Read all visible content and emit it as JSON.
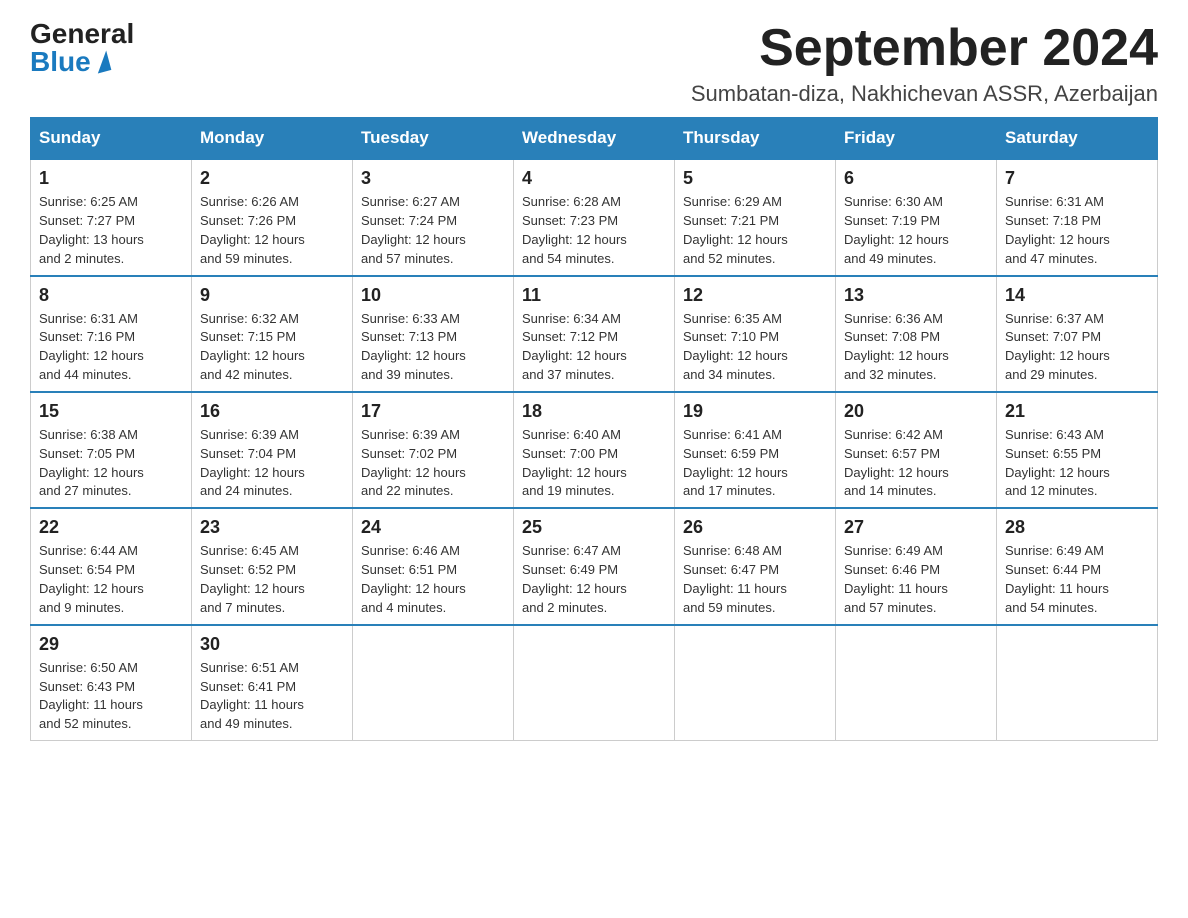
{
  "header": {
    "logo_general": "General",
    "logo_blue": "Blue",
    "month_title": "September 2024",
    "subtitle": "Sumbatan-diza, Nakhichevan ASSR, Azerbaijan"
  },
  "weekdays": [
    "Sunday",
    "Monday",
    "Tuesday",
    "Wednesday",
    "Thursday",
    "Friday",
    "Saturday"
  ],
  "weeks": [
    [
      {
        "day": "1",
        "sunrise": "6:25 AM",
        "sunset": "7:27 PM",
        "daylight": "13 hours and 2 minutes."
      },
      {
        "day": "2",
        "sunrise": "6:26 AM",
        "sunset": "7:26 PM",
        "daylight": "12 hours and 59 minutes."
      },
      {
        "day": "3",
        "sunrise": "6:27 AM",
        "sunset": "7:24 PM",
        "daylight": "12 hours and 57 minutes."
      },
      {
        "day": "4",
        "sunrise": "6:28 AM",
        "sunset": "7:23 PM",
        "daylight": "12 hours and 54 minutes."
      },
      {
        "day": "5",
        "sunrise": "6:29 AM",
        "sunset": "7:21 PM",
        "daylight": "12 hours and 52 minutes."
      },
      {
        "day": "6",
        "sunrise": "6:30 AM",
        "sunset": "7:19 PM",
        "daylight": "12 hours and 49 minutes."
      },
      {
        "day": "7",
        "sunrise": "6:31 AM",
        "sunset": "7:18 PM",
        "daylight": "12 hours and 47 minutes."
      }
    ],
    [
      {
        "day": "8",
        "sunrise": "6:31 AM",
        "sunset": "7:16 PM",
        "daylight": "12 hours and 44 minutes."
      },
      {
        "day": "9",
        "sunrise": "6:32 AM",
        "sunset": "7:15 PM",
        "daylight": "12 hours and 42 minutes."
      },
      {
        "day": "10",
        "sunrise": "6:33 AM",
        "sunset": "7:13 PM",
        "daylight": "12 hours and 39 minutes."
      },
      {
        "day": "11",
        "sunrise": "6:34 AM",
        "sunset": "7:12 PM",
        "daylight": "12 hours and 37 minutes."
      },
      {
        "day": "12",
        "sunrise": "6:35 AM",
        "sunset": "7:10 PM",
        "daylight": "12 hours and 34 minutes."
      },
      {
        "day": "13",
        "sunrise": "6:36 AM",
        "sunset": "7:08 PM",
        "daylight": "12 hours and 32 minutes."
      },
      {
        "day": "14",
        "sunrise": "6:37 AM",
        "sunset": "7:07 PM",
        "daylight": "12 hours and 29 minutes."
      }
    ],
    [
      {
        "day": "15",
        "sunrise": "6:38 AM",
        "sunset": "7:05 PM",
        "daylight": "12 hours and 27 minutes."
      },
      {
        "day": "16",
        "sunrise": "6:39 AM",
        "sunset": "7:04 PM",
        "daylight": "12 hours and 24 minutes."
      },
      {
        "day": "17",
        "sunrise": "6:39 AM",
        "sunset": "7:02 PM",
        "daylight": "12 hours and 22 minutes."
      },
      {
        "day": "18",
        "sunrise": "6:40 AM",
        "sunset": "7:00 PM",
        "daylight": "12 hours and 19 minutes."
      },
      {
        "day": "19",
        "sunrise": "6:41 AM",
        "sunset": "6:59 PM",
        "daylight": "12 hours and 17 minutes."
      },
      {
        "day": "20",
        "sunrise": "6:42 AM",
        "sunset": "6:57 PM",
        "daylight": "12 hours and 14 minutes."
      },
      {
        "day": "21",
        "sunrise": "6:43 AM",
        "sunset": "6:55 PM",
        "daylight": "12 hours and 12 minutes."
      }
    ],
    [
      {
        "day": "22",
        "sunrise": "6:44 AM",
        "sunset": "6:54 PM",
        "daylight": "12 hours and 9 minutes."
      },
      {
        "day": "23",
        "sunrise": "6:45 AM",
        "sunset": "6:52 PM",
        "daylight": "12 hours and 7 minutes."
      },
      {
        "day": "24",
        "sunrise": "6:46 AM",
        "sunset": "6:51 PM",
        "daylight": "12 hours and 4 minutes."
      },
      {
        "day": "25",
        "sunrise": "6:47 AM",
        "sunset": "6:49 PM",
        "daylight": "12 hours and 2 minutes."
      },
      {
        "day": "26",
        "sunrise": "6:48 AM",
        "sunset": "6:47 PM",
        "daylight": "11 hours and 59 minutes."
      },
      {
        "day": "27",
        "sunrise": "6:49 AM",
        "sunset": "6:46 PM",
        "daylight": "11 hours and 57 minutes."
      },
      {
        "day": "28",
        "sunrise": "6:49 AM",
        "sunset": "6:44 PM",
        "daylight": "11 hours and 54 minutes."
      }
    ],
    [
      {
        "day": "29",
        "sunrise": "6:50 AM",
        "sunset": "6:43 PM",
        "daylight": "11 hours and 52 minutes."
      },
      {
        "day": "30",
        "sunrise": "6:51 AM",
        "sunset": "6:41 PM",
        "daylight": "11 hours and 49 minutes."
      },
      null,
      null,
      null,
      null,
      null
    ]
  ],
  "labels": {
    "sunrise": "Sunrise: ",
    "sunset": "Sunset: ",
    "daylight": "Daylight: "
  }
}
